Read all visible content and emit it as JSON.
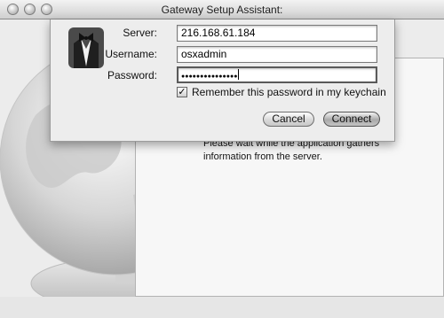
{
  "window": {
    "title": "Gateway Setup Assistant:"
  },
  "status": {
    "message": "Please wait while the application gathers information from the server."
  },
  "dialog": {
    "server": {
      "label": "Server:",
      "value": "216.168.61.184"
    },
    "username": {
      "label": "Username:",
      "value": "osxadmin"
    },
    "password": {
      "label": "Password:",
      "masked_value": "●●●●●●●●●●●●●●●"
    },
    "remember": {
      "label": "Remember this password in my keychain",
      "checked": true,
      "mark": "✓"
    },
    "buttons": {
      "cancel": "Cancel",
      "connect": "Connect"
    },
    "icon": "butler-keychain-icon"
  },
  "colors": {
    "background": "#ececec",
    "panel": "#f7f7f7",
    "sheet": "#ededed"
  }
}
